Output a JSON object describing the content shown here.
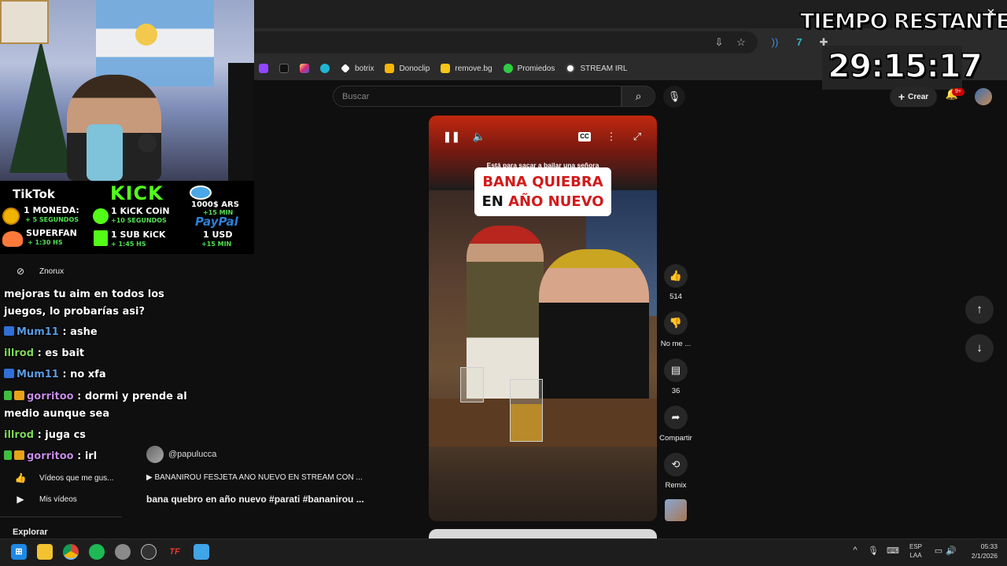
{
  "timer": {
    "label": "TIEMPO RESTANTE:",
    "value": "29:15:17"
  },
  "bookmarks": [
    {
      "label": "botrix",
      "icon": "botrix-icon",
      "color": "#ffffff"
    },
    {
      "label": "Donoclip",
      "icon": "donoclip-icon",
      "color": "#f5b50a"
    },
    {
      "label": "remove.bg",
      "icon": "removebg-icon",
      "color": "#f5c518"
    },
    {
      "label": "Promiedos",
      "icon": "promiedos-icon",
      "color": "#2ecc40"
    },
    {
      "label": "STREAM IRL",
      "icon": "soccer-ball-icon",
      "color": "#ffffff"
    }
  ],
  "youtube": {
    "search_placeholder": "Buscar",
    "create_label": "Crear",
    "notifications_badge": "9+"
  },
  "donations": {
    "tiktok_title": "TikTok",
    "tiktok_coin": "1 MONEDA:",
    "tiktok_coin_reward": "+ 5 SEGUNDOS",
    "tiktok_superfan": "SUPERFAN",
    "tiktok_superfan_reward": "+ 1:30 HS",
    "kick_title": "KICK",
    "kick_coin": "1 KiCK COiN",
    "kick_coin_reward": "+10 SEGUNDOS",
    "kick_sub": "1 SUB KiCK",
    "kick_sub_reward": "+ 1:45 HS",
    "mp_amount": "1000$ ARS",
    "mp_reward": "+15 MIN",
    "paypal_title": "PayPal",
    "paypal_amount": "1 USD",
    "paypal_reward": "+15 MIN"
  },
  "sidebar": {
    "top_item": "Znorux",
    "liked_videos": "Vídeos que me gus...",
    "my_videos": "Mis vídeos",
    "explore": "Explorar"
  },
  "chat": [
    {
      "user": "",
      "message": "mejoras tu aim en todos los juegos, lo probarías asi?",
      "user_color": "#ffffff"
    },
    {
      "user": "Mum11",
      "message": ": ashe",
      "user_color": "#5a9be0"
    },
    {
      "user": "illrod",
      "message": ": es bait",
      "user_color": "#7fd858"
    },
    {
      "user": "Mum11",
      "message": ": no xfa",
      "user_color": "#5a9be0"
    },
    {
      "user": "gorritoo",
      "message": ": dormi y prende al medio aunque sea",
      "user_color": "#c78de8"
    },
    {
      "user": "illrod",
      "message": ": juga cs",
      "user_color": "#7fd858"
    },
    {
      "user": "gorritoo",
      "message": ": irl",
      "user_color": "#c78de8"
    }
  ],
  "short": {
    "caption_small": "Está para sacar a bailar una señora",
    "caption_line1_black": "BANA ",
    "caption_line1_red": "QUIEBRA",
    "caption_line2_black": "EN ",
    "caption_line2_red": "AÑO NUEVO",
    "channel": "@papulucca",
    "playlist": "BANANIROU FESJETA AÑO NUEVO EN STREAM CON ...",
    "title": "bana quebro en año nuevo #parati #bananirou ..."
  },
  "actions": {
    "likes": "514",
    "dislike_label": "No me ...",
    "comments": "36",
    "share_label": "Compartir",
    "remix_label": "Remix"
  },
  "taskbar": {
    "lang_line1": "ESP",
    "lang_line2": "LAA",
    "time": "05:33",
    "date": "2/1/2026"
  }
}
